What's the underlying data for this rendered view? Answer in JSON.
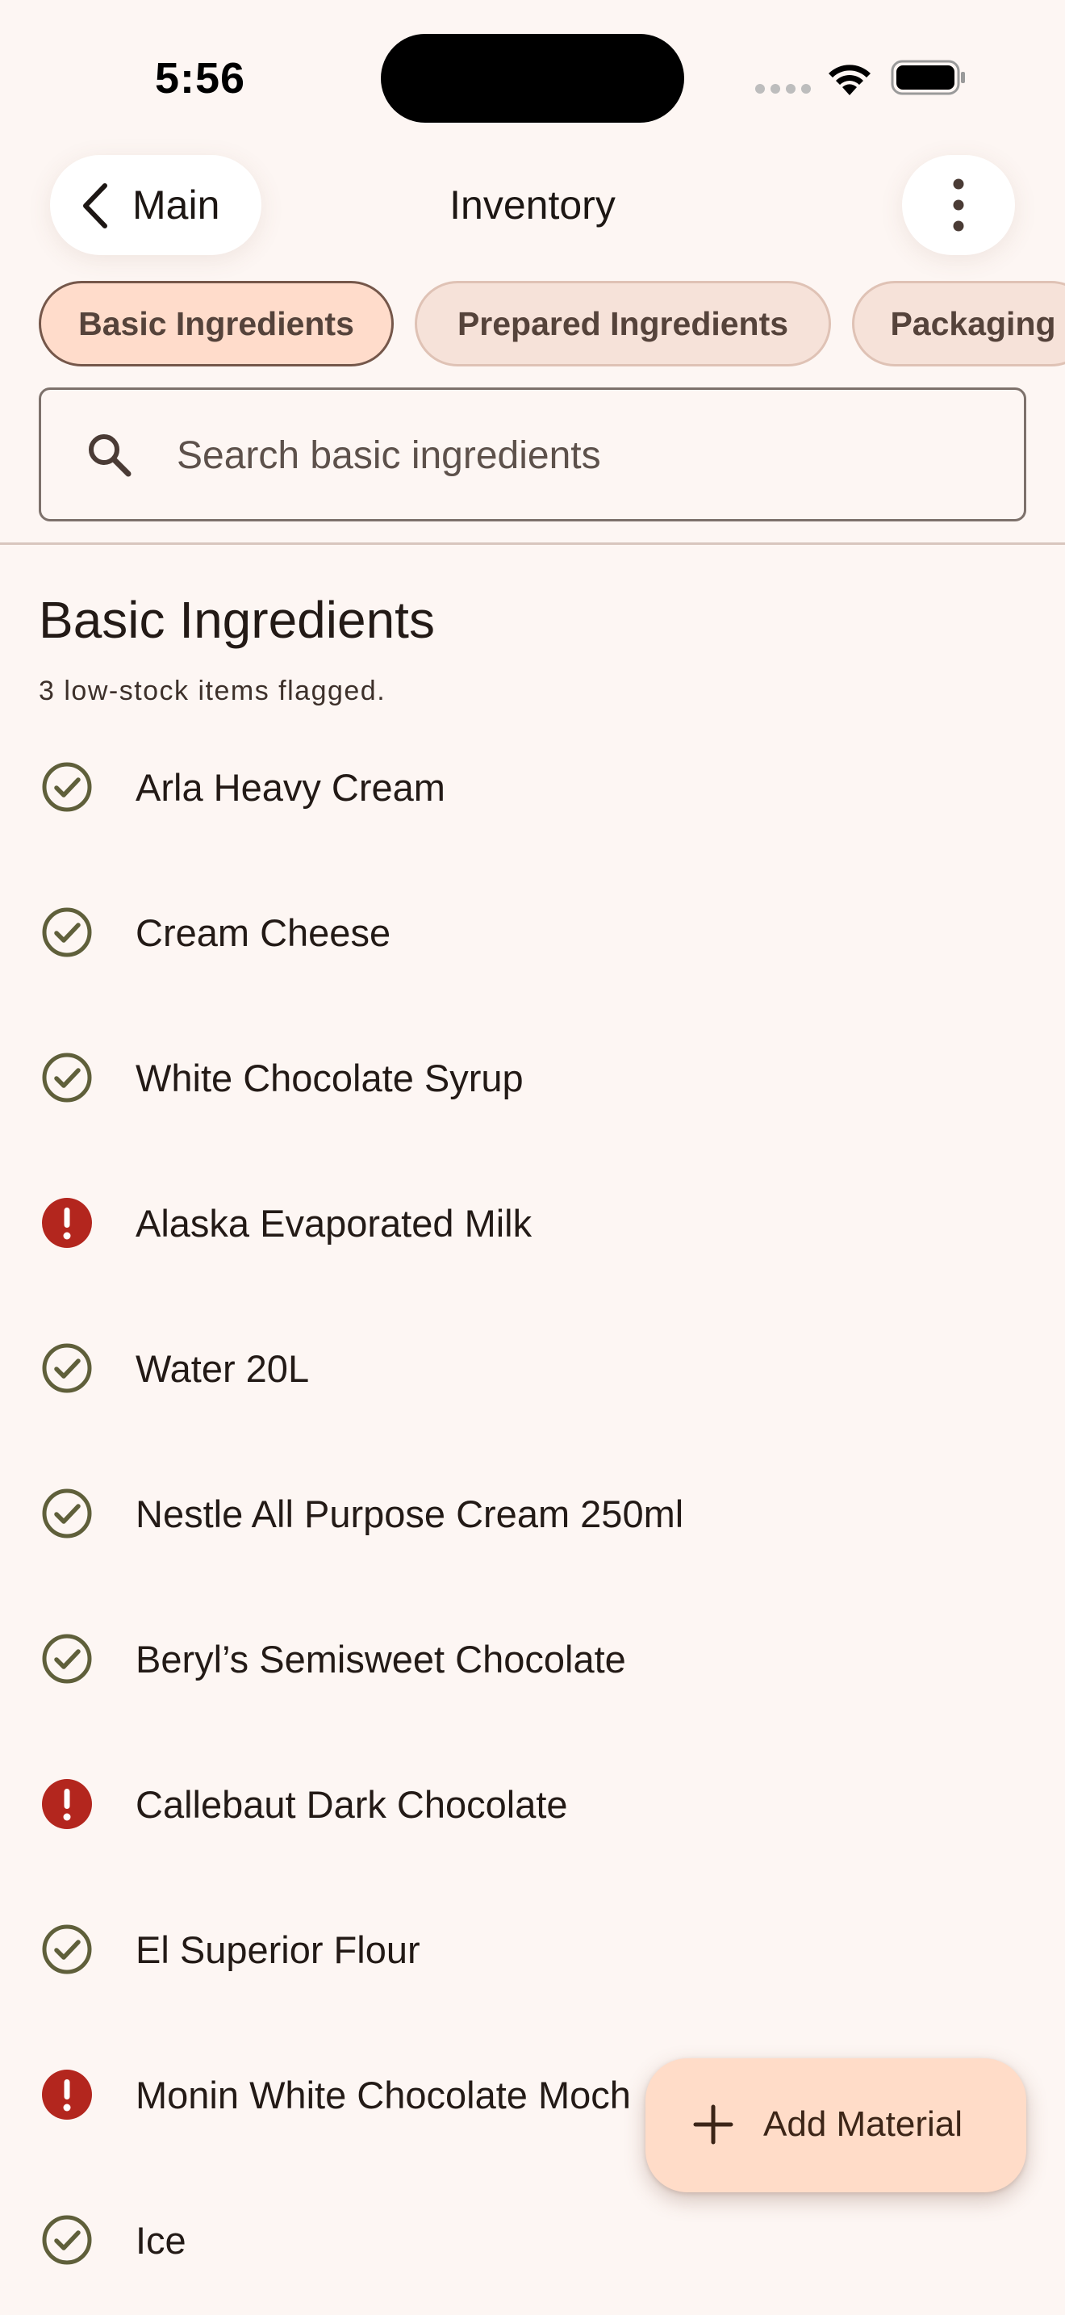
{
  "status_bar": {
    "time": "5:56"
  },
  "nav": {
    "back_label": "Main",
    "title": "Inventory"
  },
  "tabs": [
    {
      "label": "Basic Ingredients",
      "active": true
    },
    {
      "label": "Prepared Ingredients",
      "active": false
    },
    {
      "label": "Packaging",
      "active": false
    }
  ],
  "search": {
    "placeholder": "Search basic ingredients",
    "value": ""
  },
  "section": {
    "title": "Basic Ingredients",
    "subtitle": "3 low-stock items flagged."
  },
  "items": [
    {
      "name": "Arla Heavy Cream",
      "status": "ok"
    },
    {
      "name": "Cream Cheese",
      "status": "ok"
    },
    {
      "name": "White Chocolate Syrup",
      "status": "ok"
    },
    {
      "name": "Alaska Evaporated Milk",
      "status": "low"
    },
    {
      "name": "Water 20L",
      "status": "ok"
    },
    {
      "name": "Nestle All Purpose Cream 250ml",
      "status": "ok"
    },
    {
      "name": "Beryl’s Semisweet Chocolate",
      "status": "ok"
    },
    {
      "name": "Callebaut Dark Chocolate",
      "status": "low"
    },
    {
      "name": "El Superior Flour",
      "status": "ok"
    },
    {
      "name": "Monin White Chocolate Moch",
      "status": "low"
    },
    {
      "name": "Ice",
      "status": "ok"
    }
  ],
  "fab": {
    "label": "Add Material",
    "icon": "plus-icon"
  },
  "icons": {
    "ok": "check-circle-icon",
    "low": "alert-circle-icon"
  },
  "colors": {
    "ok": "#5f5f3a",
    "low": "#b3261e",
    "active_tab_bg": "#ffdccb",
    "fab_bg": "#ffdcc8"
  }
}
